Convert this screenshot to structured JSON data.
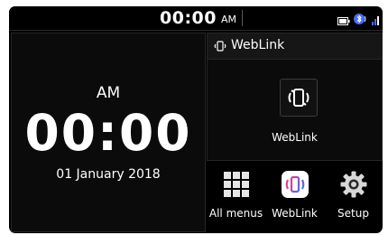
{
  "status_bar": {
    "time": "00:00",
    "ampm": "AM",
    "icons": [
      "battery-icon",
      "bluetooth-audio-icon",
      "signal-icon"
    ]
  },
  "clock": {
    "ampm": "AM",
    "time": "00:00",
    "date": "01 January 2018"
  },
  "weblink_widget": {
    "title": "WebLink",
    "app_label": "WebLink"
  },
  "shortcuts": [
    {
      "label": "All menus",
      "icon": "grid-icon"
    },
    {
      "label": "WebLink",
      "icon": "weblink-icon"
    },
    {
      "label": "Setup",
      "icon": "gear-icon"
    }
  ],
  "colors": {
    "background": "#000000",
    "panel": "#0b0b0b",
    "text": "#ffffff",
    "accent_pink": "#e0418f",
    "accent_blue": "#4a6cf0"
  }
}
